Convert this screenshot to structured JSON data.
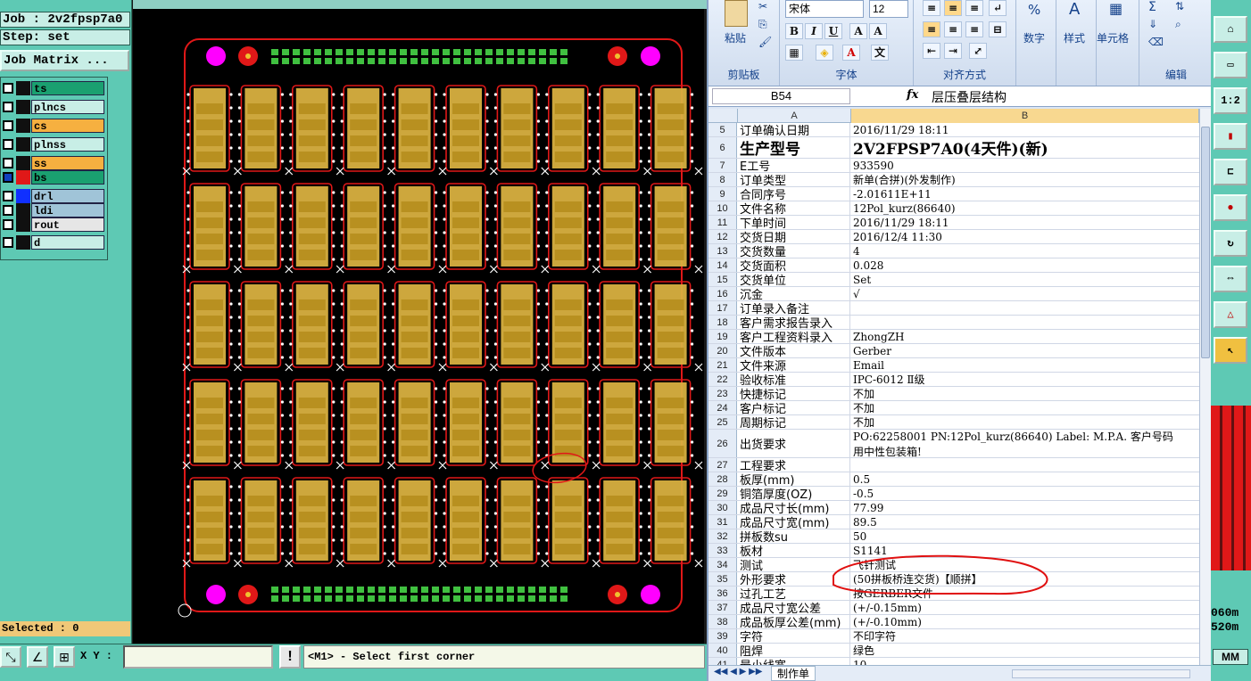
{
  "cad": {
    "job_label": "Job : 2v2fpsp7a0",
    "step_label": "Step: set",
    "job_matrix_button": "Job Matrix ...",
    "layers": [
      {
        "name": "ts",
        "color": "#1aa070",
        "checked": false
      },
      {
        "name": "plncs",
        "color": "#c8eee6",
        "checked": false
      },
      {
        "name": "cs",
        "color": "#f6b040",
        "checked": false
      },
      {
        "name": "plnss",
        "color": "#c8eee6",
        "checked": false
      },
      {
        "name": "ss",
        "color": "#f6b040",
        "checked": false
      },
      {
        "name": "bs",
        "color": "#1aa070",
        "checked": true
      },
      {
        "name": "drl",
        "color": "#a0c4d8",
        "checked": false
      },
      {
        "name": "ldi",
        "color": "#a0c4d8",
        "checked": false
      },
      {
        "name": "rout",
        "color": "#e6e6e6",
        "checked": false
      },
      {
        "name": "d",
        "color": "#c8eee6",
        "checked": false
      }
    ],
    "selected_label": "Selected : 0",
    "xy_label": "X Y :",
    "xy_value": "",
    "status_message": "<M1> - Select first corner",
    "exclaim": "!",
    "board": {
      "columns": 10,
      "rows": 5
    }
  },
  "excel": {
    "font_name": "宋体",
    "font_size": "12",
    "paste_label": "粘贴",
    "group_clipboard": "剪贴板",
    "group_font": "字体",
    "group_align": "对齐方式",
    "number_label": "数字",
    "number_symbol": "%",
    "style_label": "样式",
    "cell_label": "单元格",
    "group_edit": "编辑",
    "name_box": "B54",
    "fx": "fx",
    "formula_content": "层压叠层结构",
    "col_a": "A",
    "col_b": "B",
    "rows": [
      {
        "n": "5",
        "a": "订单确认日期",
        "b": "2016/11/29 18:11"
      },
      {
        "n": "6",
        "a": "生产型号",
        "b": "2V2FPSP7A0(4天件)(新)",
        "big": true
      },
      {
        "n": "7",
        "a": "E工号",
        "b": "933590"
      },
      {
        "n": "8",
        "a": "订单类型",
        "b": "新单(合拼)(外发制作)"
      },
      {
        "n": "9",
        "a": "合同序号",
        "b": "-2.01611E+11"
      },
      {
        "n": "10",
        "a": "文件名称",
        "b": "12Pol_kurz(86640)"
      },
      {
        "n": "11",
        "a": "下单时间",
        "b": "2016/11/29 18:11"
      },
      {
        "n": "12",
        "a": "交货日期",
        "b": "2016/12/4 11:30"
      },
      {
        "n": "13",
        "a": "交货数量",
        "b": "4"
      },
      {
        "n": "14",
        "a": "交货面积",
        "b": "0.028"
      },
      {
        "n": "15",
        "a": "交货单位",
        "b": "Set"
      },
      {
        "n": "16",
        "a": "沉金",
        "b": "√"
      },
      {
        "n": "17",
        "a": "订单录入备注",
        "b": ""
      },
      {
        "n": "18",
        "a": "客户需求报告录入",
        "b": ""
      },
      {
        "n": "19",
        "a": "客户工程资料录入",
        "b": "ZhongZH"
      },
      {
        "n": "20",
        "a": "文件版本",
        "b": "Gerber"
      },
      {
        "n": "21",
        "a": "文件来源",
        "b": "Email"
      },
      {
        "n": "22",
        "a": "验收标准",
        "b": "IPC-6012 Ⅱ级"
      },
      {
        "n": "23",
        "a": "快捷标记",
        "b": "不加"
      },
      {
        "n": "24",
        "a": "客户标记",
        "b": "不加"
      },
      {
        "n": "25",
        "a": "周期标记",
        "b": "不加"
      },
      {
        "n": "26",
        "a": "出货要求",
        "b": "PO:62258001 PN:12Pol_kurz(86640) Label: M.P.A. 客户号码",
        "b2": "用中性包装箱!",
        "tall": true
      },
      {
        "n": "27",
        "a": "工程要求",
        "b": ""
      },
      {
        "n": "28",
        "a": "板厚(mm)",
        "b": "0.5"
      },
      {
        "n": "29",
        "a": "铜箔厚度(OZ)",
        "b": "-0.5"
      },
      {
        "n": "30",
        "a": "成品尺寸长(mm)",
        "b": "77.99"
      },
      {
        "n": "31",
        "a": "成品尺寸宽(mm)",
        "b": "89.5"
      },
      {
        "n": "32",
        "a": "拼板数su",
        "b": "50"
      },
      {
        "n": "33",
        "a": "板材",
        "b": "S1141"
      },
      {
        "n": "34",
        "a": "测试",
        "b": "飞针测试"
      },
      {
        "n": "35",
        "a": "外形要求",
        "b": "(50拼板桥连交货)【顺拼】"
      },
      {
        "n": "36",
        "a": "过孔工艺",
        "b": "按GERBER文件"
      },
      {
        "n": "37",
        "a": "成品尺寸宽公差",
        "b": "(+/-0.15mm)"
      },
      {
        "n": "38",
        "a": "成品板厚公差(mm)",
        "b": "(+/-0.10mm)"
      },
      {
        "n": "39",
        "a": "字符",
        "b": "不印字符"
      },
      {
        "n": "40",
        "a": "阻焊",
        "b": "绿色"
      },
      {
        "n": "41",
        "a": "最小线宽",
        "b": "10"
      }
    ],
    "sheet_tab": "制作单"
  },
  "right_toolbar": {
    "ratio": "1:2",
    "readout1": "060m",
    "readout2": "520m",
    "unit": "MM"
  }
}
